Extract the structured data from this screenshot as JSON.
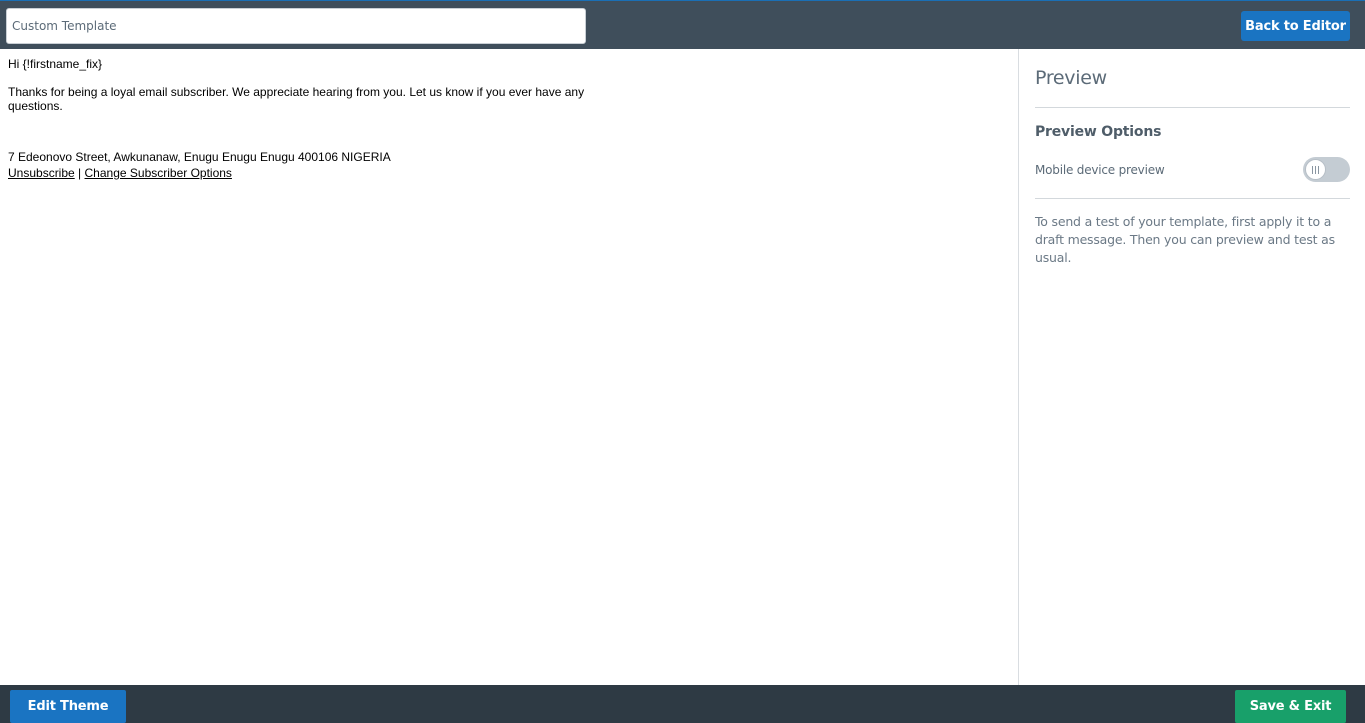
{
  "header": {
    "template_name": "Custom Template",
    "back_button": "Back to Editor"
  },
  "email": {
    "greeting": "Hi {!firstname_fix}",
    "body": "Thanks for being a loyal email subscriber. We appreciate hearing from you. Let us know if you ever have any questions.",
    "address": "7 Edeonovo Street, Awkunanaw, Enugu Enugu Enugu 400106 NIGERIA",
    "unsubscribe_link": "Unsubscribe",
    "separator": "|",
    "change_options_link": "Change Subscriber Options"
  },
  "preview_panel": {
    "title": "Preview",
    "options_heading": "Preview Options",
    "mobile_label": "Mobile device preview",
    "mobile_preview_enabled": false,
    "help_text": "To send a test of your template, first apply it to a draft message. Then you can preview and test as usual."
  },
  "footer": {
    "edit_theme_button": "Edit Theme",
    "save_exit_button": "Save & Exit"
  },
  "colors": {
    "header_bg": "#3f4e5b",
    "footer_bg": "#2e3a44",
    "primary_button": "#1a74c2",
    "save_button": "#18a06a"
  }
}
